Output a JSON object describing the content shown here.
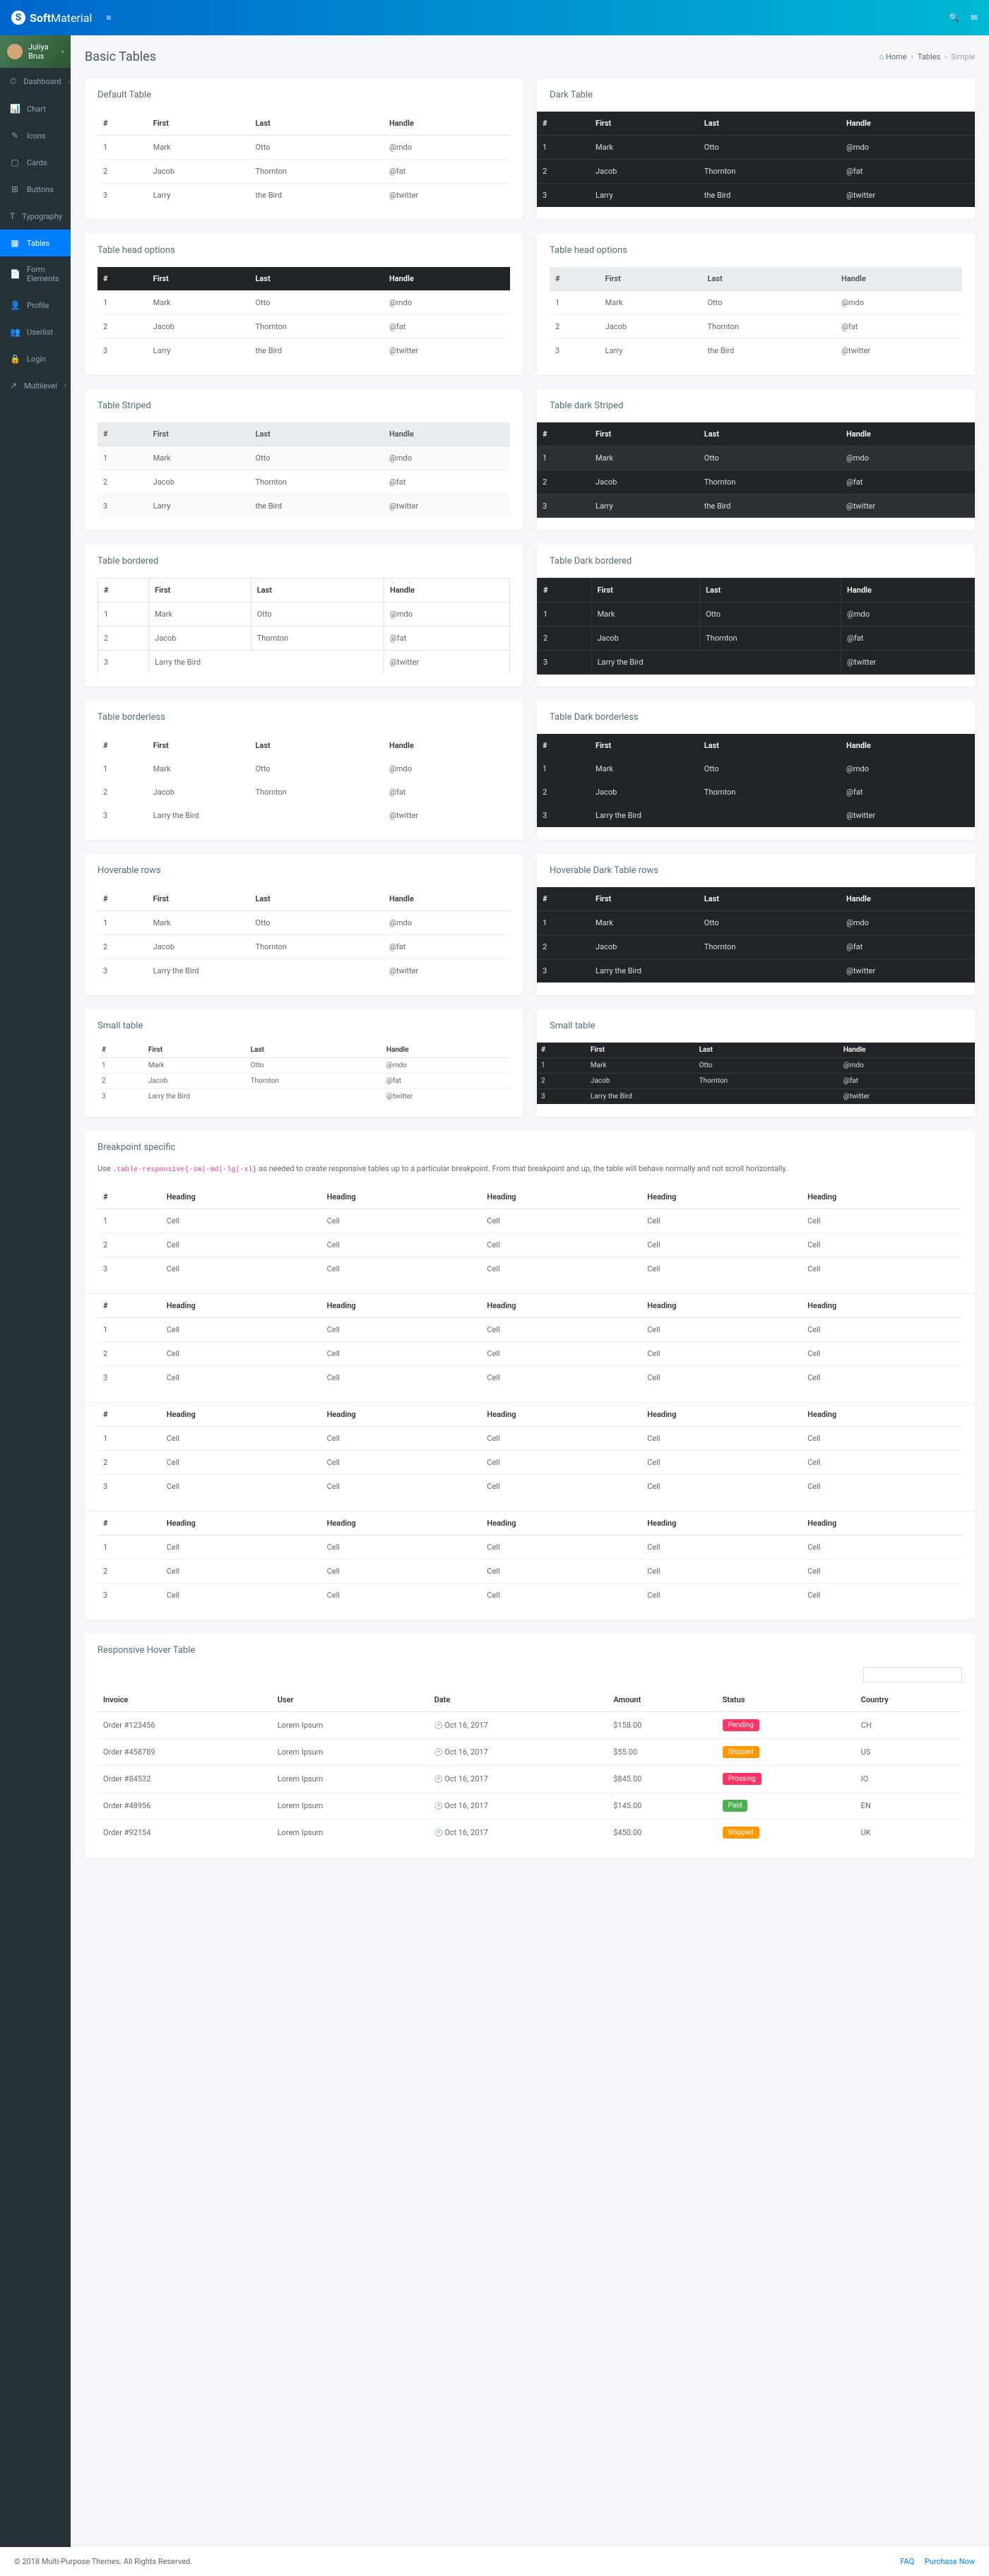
{
  "logo": {
    "bold": "Soft",
    "light": "Material"
  },
  "user": {
    "name": "Juliya Brus"
  },
  "nav": [
    {
      "icon": "⏱",
      "label": "Dashboard",
      "chev": true
    },
    {
      "icon": "📊",
      "label": "Chart"
    },
    {
      "icon": "✎",
      "label": "Icons"
    },
    {
      "icon": "▢",
      "label": "Cards"
    },
    {
      "icon": "⊞",
      "label": "Buttons"
    },
    {
      "icon": "T",
      "label": "Typography"
    },
    {
      "icon": "▦",
      "label": "Tables",
      "active": true
    },
    {
      "icon": "📄",
      "label": "Form Elements"
    },
    {
      "icon": "👤",
      "label": "Profile"
    },
    {
      "icon": "👥",
      "label": "Userlist"
    },
    {
      "icon": "🔒",
      "label": "Login"
    },
    {
      "icon": "↗",
      "label": "Multilevel",
      "chev": true
    }
  ],
  "page": {
    "title": "Basic Tables"
  },
  "crumb": [
    {
      "icon": "⌂",
      "label": "Home"
    },
    {
      "label": "Tables"
    },
    {
      "label": "Simple"
    }
  ],
  "cols": [
    "#",
    "First",
    "Last",
    "Handle"
  ],
  "rows": [
    [
      "1",
      "Mark",
      "Otto",
      "@mdo"
    ],
    [
      "2",
      "Jacob",
      "Thornton",
      "@fat"
    ],
    [
      "3",
      "Larry",
      "the Bird",
      "@twitter"
    ]
  ],
  "rows_colspan": [
    [
      "1",
      "Mark",
      "Otto",
      "@mdo"
    ],
    [
      "2",
      "Jacob",
      "Thornton",
      "@fat"
    ],
    [
      "3",
      "Larry the Bird",
      "",
      "@twitter"
    ]
  ],
  "cards": {
    "default": "Default Table",
    "dark": "Dark Table",
    "thead_opts": "Table head options",
    "striped": "Table Striped",
    "dstriped": "Table dark Striped",
    "bordered": "Table bordered",
    "dbordered": "Table Dark bordered",
    "borderless": "Table borderless",
    "dborderless": "Table Dark borderless",
    "hover": "Hoverable rows",
    "dhover": "Hoverable Dark Table rows",
    "small": "Small table",
    "breakpoint": "Breakpoint specific",
    "responsive": "Responsive Hover Table"
  },
  "bp_desc": {
    "pre": "Use ",
    "code": ".table-responsive{-sm|-md|-lg|-xl}",
    "post": " as needed to create responsive tables up to a particular breakpoint. From that breakpoint and up, the table will behave normally and not scroll horizontally."
  },
  "bp_cols": [
    "#",
    "Heading",
    "Heading",
    "Heading",
    "Heading",
    "Heading"
  ],
  "bp_rows": [
    [
      "1",
      "Cell",
      "Cell",
      "Cell",
      "Cell",
      "Cell"
    ],
    [
      "2",
      "Cell",
      "Cell",
      "Cell",
      "Cell",
      "Cell"
    ],
    [
      "3",
      "Cell",
      "Cell",
      "Cell",
      "Cell",
      "Cell"
    ]
  ],
  "resp_cols": [
    "Invoice",
    "User",
    "Date",
    "Amount",
    "Status",
    "Country"
  ],
  "resp_rows": [
    {
      "inv": "Order #123456",
      "user": "Lorem Ipsum",
      "date": "Oct 16, 2017",
      "amt": "$158.00",
      "status": "Pending",
      "scls": "b-pending",
      "ctry": "CH"
    },
    {
      "inv": "Order #458789",
      "user": "Lorem Ipsum",
      "date": "Oct 16, 2017",
      "amt": "$55.00",
      "status": "Shipped",
      "scls": "b-shipped",
      "ctry": "US"
    },
    {
      "inv": "Order #84532",
      "user": "Lorem Ipsum",
      "date": "Oct 16, 2017",
      "amt": "$845.00",
      "status": "Prossing",
      "scls": "b-prossing",
      "ctry": "IO"
    },
    {
      "inv": "Order #48956",
      "user": "Lorem Ipsum",
      "date": "Oct 16, 2017",
      "amt": "$145.00",
      "status": "Paid",
      "scls": "b-paid",
      "ctry": "EN"
    },
    {
      "inv": "Order #92154",
      "user": "Lorem Ipsum",
      "date": "Oct 16, 2017",
      "amt": "$450.00",
      "status": "Shipped",
      "scls": "b-shipped",
      "ctry": "UK"
    }
  ],
  "footer": {
    "copy": "© 2018 Multi-Purpose Themes. All Rights Reserved.",
    "faq": "FAQ",
    "buy": "Purchase Now"
  }
}
